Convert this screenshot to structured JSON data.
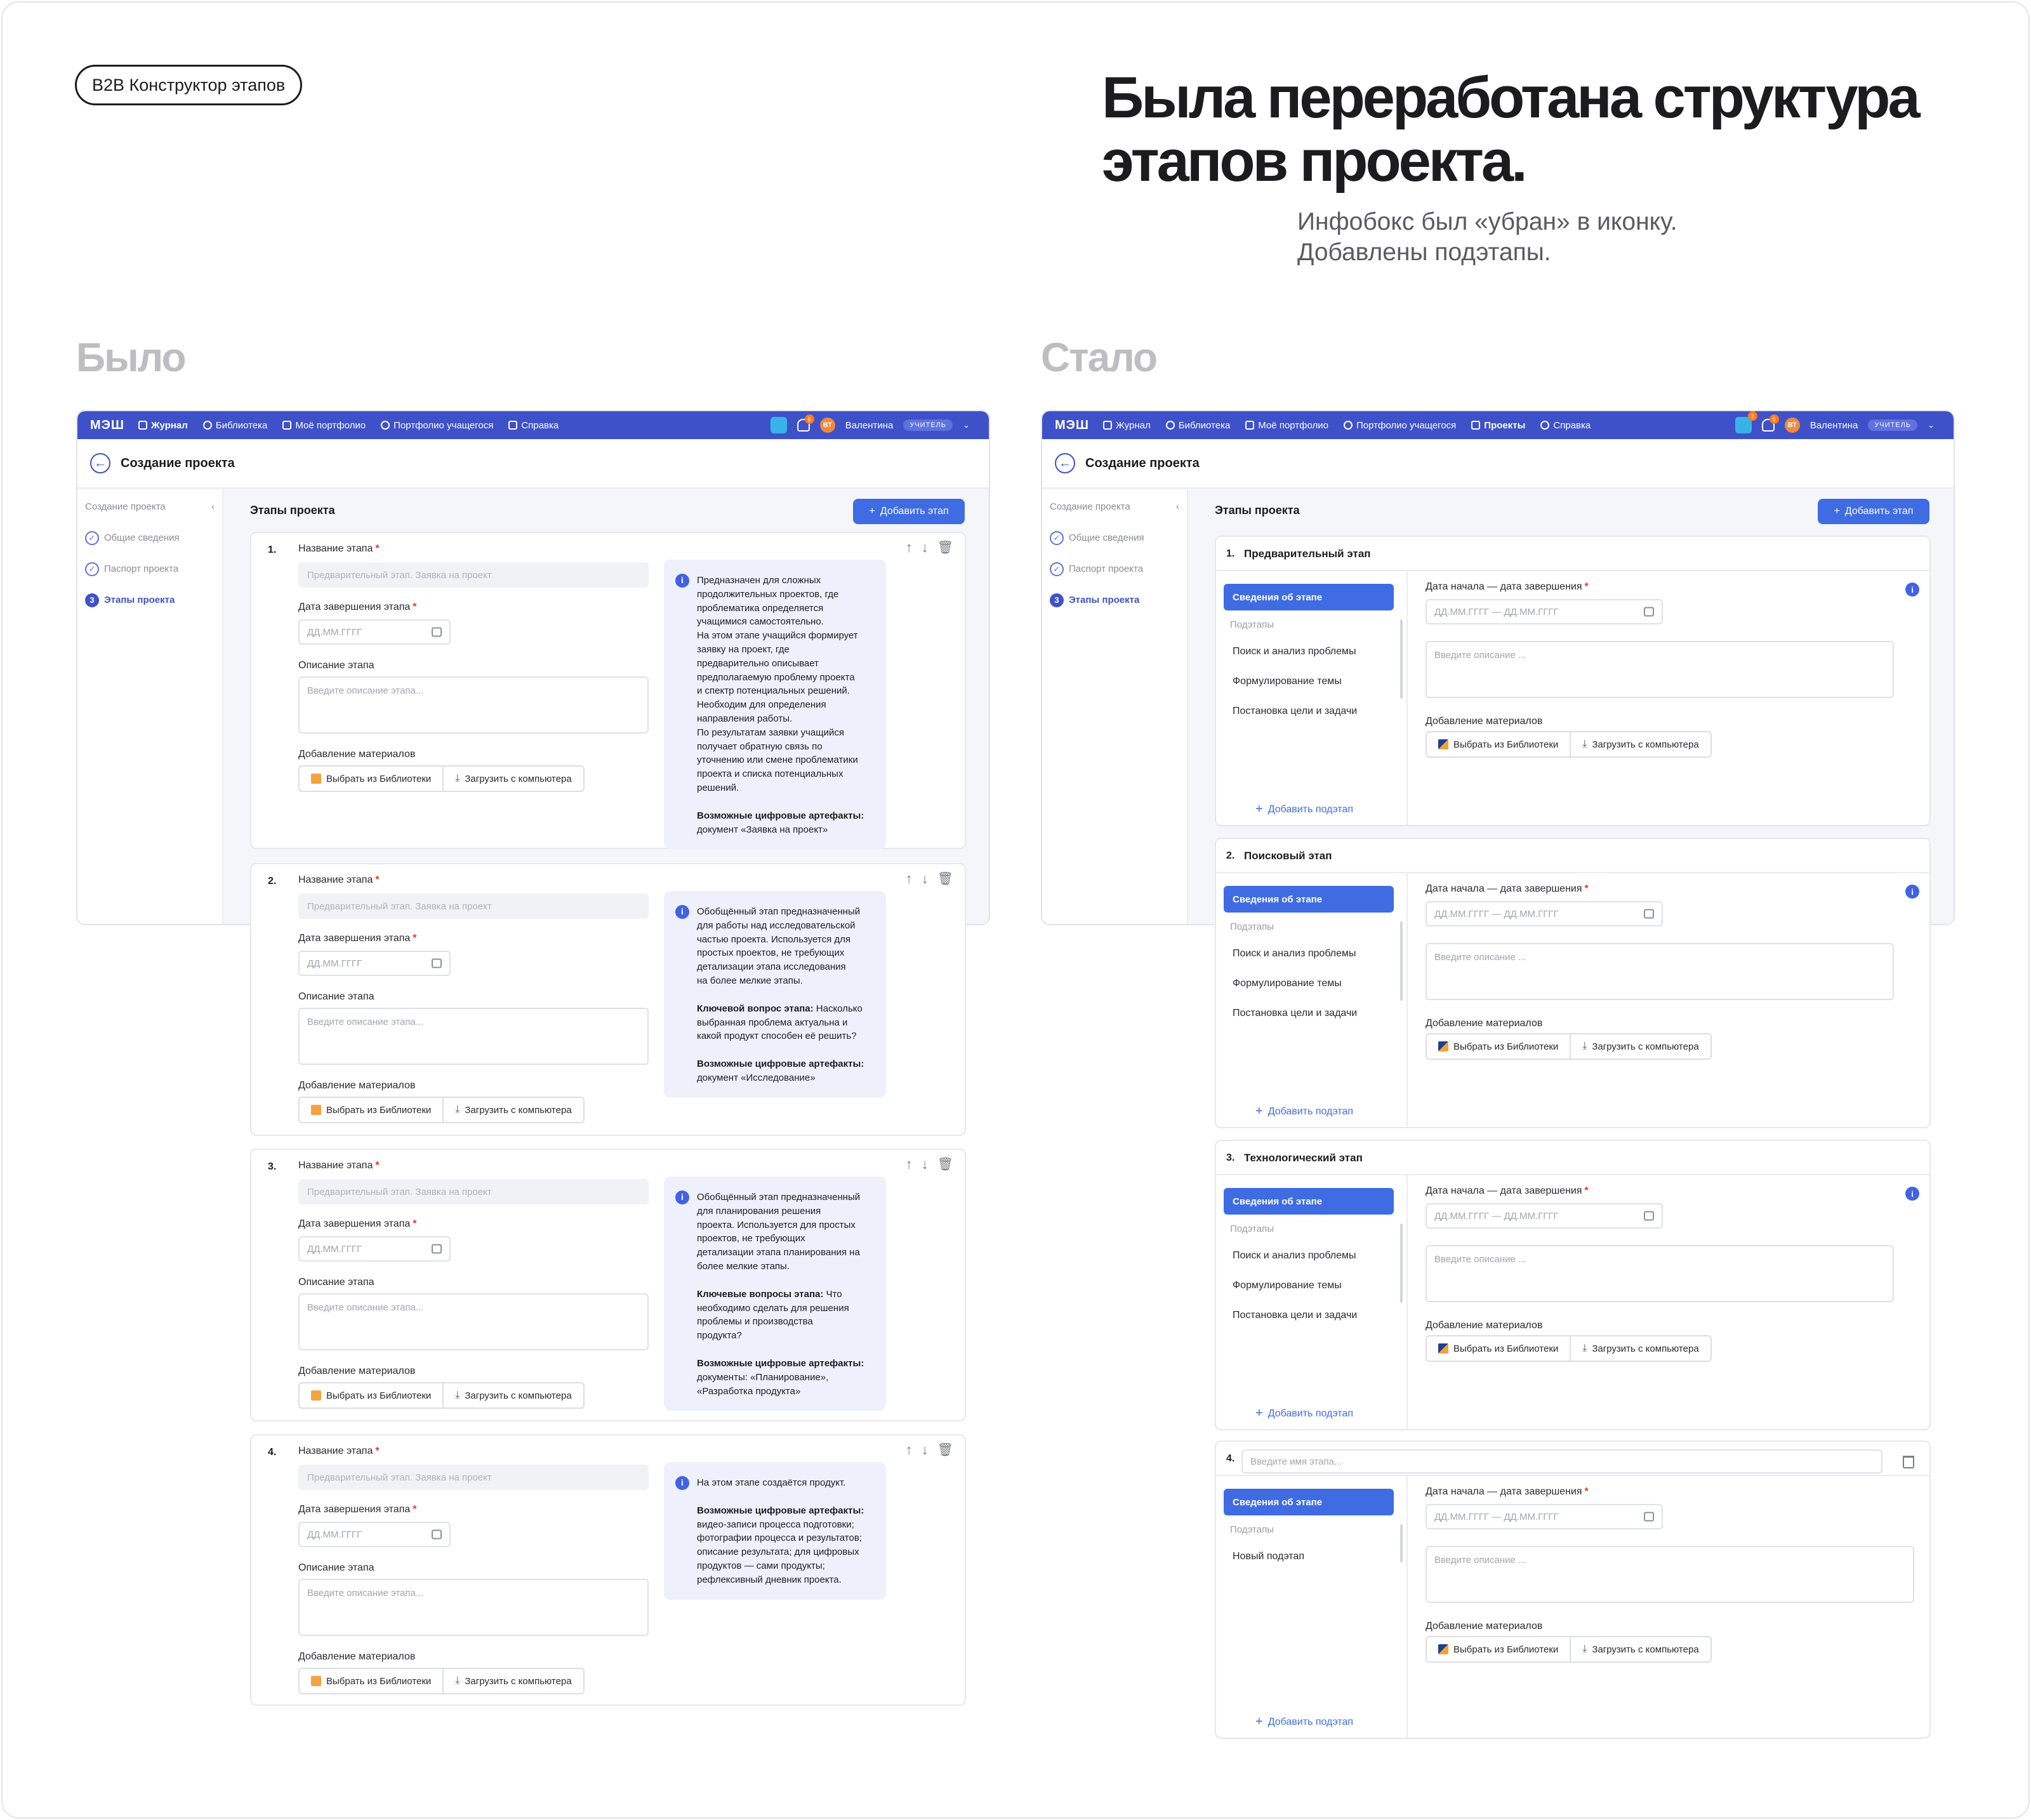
{
  "tag": "B2B Конструктор этапов",
  "headline": [
    "Была переработана структура",
    "этапов проекта."
  ],
  "subline": [
    "Инфобокс был «убран» в иконку.",
    "Добавлены подэтапы."
  ],
  "before_label": "Было",
  "after_label": "Стало",
  "nav": {
    "logo": "МЭШ",
    "items_before": [
      "Журнал",
      "Библиотека",
      "Моё портфолио",
      "Портфолио учащегося",
      "Справка"
    ],
    "items_after": [
      "Журнал",
      "Библиотека",
      "Моё портфолио",
      "Портфолио учащегося",
      "Проекты",
      "Справка"
    ],
    "user": "Валентина",
    "initials": "ВТ",
    "role": "УЧИТЕЛЬ",
    "badge_before": "5",
    "badge_after_1": "3",
    "badge_after_2": "5"
  },
  "page_title": "Создание проекта",
  "sidebar": {
    "head": "Создание проекта",
    "items": [
      "Общие сведения",
      "Паспорт проекта",
      "Этапы проекта"
    ],
    "active_number": "3"
  },
  "content_title": "Этапы проекта",
  "add_stage": "Добавить этап",
  "old_form": {
    "name_label": "Название этапа",
    "name_placeholder": "Предварительный этап. Заявка на проект",
    "date_label": "Дата завершения этапа",
    "date_placeholder": "ДД.ММ.ГГГГ",
    "desc_label": "Описание этапа",
    "desc_placeholder": "Введите описание этапа...",
    "materials_label": "Добавление материалов",
    "from_library": "Выбрать из Библиотеки",
    "upload": "Загрузить с компьютера"
  },
  "old_stages": [
    {
      "num": "1.",
      "info": [
        {
          "lines": [
            "Предназначен для сложных",
            "продолжительных проектов, где",
            "проблематика определяется",
            "учащимися самостоятельно.",
            "На этом этапе учащийся формирует",
            "заявку на проект, где",
            "предварительно описывает",
            "предполагаемую проблему проекта",
            "и спектр потенциальных решений.",
            "Необходим для определения",
            "направления работы.",
            "По результатам заявки учащийся",
            "получает обратную связь по",
            "уточнению или смене проблематики",
            "проекта и списка потенциальных",
            "решений."
          ]
        },
        {
          "bold": "Возможные цифровые артефакты:",
          "lines": [
            "документ «Заявка на проект»"
          ]
        }
      ]
    },
    {
      "num": "2.",
      "info": [
        {
          "lines": [
            "Обобщённый этап предназначенный",
            "для работы над исследовательской",
            "частью проекта. Используется для",
            "простых проектов, не требующих",
            "детализации этапа исследования",
            "на более мелкие этапы."
          ]
        },
        {
          "bold": "Ключевой вопрос этапа:",
          "tail": " Насколько",
          "lines": [
            "выбранная проблема актуальна и",
            "какой продукт способен её решить?"
          ]
        },
        {
          "bold": "Возможные цифровые артефакты:",
          "lines": [
            "документ «Исследование»"
          ]
        }
      ]
    },
    {
      "num": "3.",
      "info": [
        {
          "lines": [
            "Обобщённый этап предназначенный",
            "для планирования решения",
            "проекта. Используется для простых",
            "проектов, не требующих",
            "детализации этапа планирования на",
            "более мелкие этапы."
          ]
        },
        {
          "bold": "Ключевые вопросы этапа:",
          "tail": "  Что",
          "lines": [
            "необходимо сделать для решения",
            "проблемы и производства",
            "продукта?"
          ]
        },
        {
          "bold": "Возможные цифровые артефакты:",
          "lines": [
            "документы: «Планирование»,",
            "«Разработка продукта»"
          ]
        }
      ]
    },
    {
      "num": "4.",
      "info": [
        {
          "lines": [
            "На этом этапе создаётся продукт."
          ]
        },
        {
          "bold": "Возможные цифровые артефакты:",
          "lines": [
            "видео-записи процесса подготовки;",
            "фотографии процесса и результатов;",
            "описание результата; для цифровых",
            "продуктов — сами продукты;",
            "рефлексивный дневник проекта."
          ]
        }
      ]
    }
  ],
  "new_form": {
    "info_tab": "Сведения об этапе",
    "substages_caption": "Подэтапы",
    "add_substage": "Добавить подэтап",
    "date_label": "Дата начала — дата завершения",
    "date_placeholder": "ДД.ММ.ГГГГ — ДД.ММ.ГГГГ",
    "desc_placeholder": "Введите описание ...",
    "materials_label": "Добавление материалов",
    "from_library": "Выбрать из Библиотеки",
    "upload": "Загрузить с компьютера",
    "name_placeholder": "Введите имя этапа...",
    "info_icon": "i"
  },
  "new_stages": [
    {
      "num": "1.",
      "title": "Предварительный этап",
      "subs": [
        "Поиск и анализ проблемы",
        "Формулирование темы",
        "Постановка цели и задачи"
      ]
    },
    {
      "num": "2.",
      "title": "Поисковый этап",
      "subs": [
        "Поиск и анализ проблемы",
        "Формулирование темы",
        "Постановка цели и задачи"
      ]
    },
    {
      "num": "3.",
      "title": "Технологический этап",
      "subs": [
        "Поиск и анализ проблемы",
        "Формулирование темы",
        "Постановка цели и задачи"
      ]
    },
    {
      "num": "4.",
      "title": "",
      "subs": [
        "Новый подэтап"
      ]
    }
  ],
  "icons": {
    "back": "arrow-left-icon",
    "up": "arrow-up-icon",
    "down": "arrow-down-icon",
    "trash": "trash-icon",
    "calendar": "calendar-icon",
    "info": "info-icon",
    "plus": "plus-icon",
    "check": "check-icon"
  },
  "colors": {
    "nav": "#3f51c9",
    "accent": "#3f6ce3",
    "required": "#e2382b",
    "infobox": "#eef1fc"
  }
}
